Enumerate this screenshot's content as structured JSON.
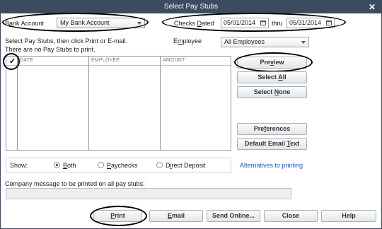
{
  "window": {
    "title": "Select Pay Stubs",
    "close_glyph": "✕"
  },
  "bank_account": {
    "label_prefix": "B",
    "label_underline": "a",
    "label_suffix": "nk Account",
    "value": "My Bank Account"
  },
  "checks_dated": {
    "label_prefix": "Checks ",
    "label_underline": "D",
    "label_suffix": "ated",
    "from": "05/01/2014",
    "thru_label": "thru",
    "to": "05/31/2014"
  },
  "instructions": {
    "line1": "Select Pay Stubs, then click Print or E-mail.",
    "line2": "There are no Pay Stubs to print."
  },
  "employee": {
    "label_prefix": "E",
    "label_underline": "m",
    "label_suffix": "ployee",
    "value": "All Employees"
  },
  "table": {
    "check_header": "✓",
    "columns": [
      "DATE",
      "EMPLOYEE",
      "AMOUNT"
    ]
  },
  "side_buttons": {
    "preview": {
      "prefix": "Pre",
      "underline": "v",
      "suffix": "iew"
    },
    "select_all": {
      "prefix": "Select ",
      "underline": "A",
      "suffix": "ll"
    },
    "select_none": {
      "prefix": "Select ",
      "underline": "N",
      "suffix": "one"
    },
    "preferences": {
      "prefix": "Pre",
      "underline": "f",
      "suffix": "erences"
    },
    "default_email": {
      "prefix": "Default Email ",
      "underline": "T",
      "suffix": "ext"
    }
  },
  "show": {
    "label": "Show:",
    "options": [
      {
        "prefix": "",
        "underline": "B",
        "suffix": "oth",
        "selected": true
      },
      {
        "prefix": "",
        "underline": "P",
        "suffix": "aychecks",
        "selected": false
      },
      {
        "prefix": "D",
        "underline": "i",
        "suffix": "rect Deposit",
        "selected": false
      }
    ],
    "alternatives_link": "Alternatives to printing"
  },
  "company_message": {
    "label": "Company message to be printed on all pay stubs:",
    "value": ""
  },
  "bottom_buttons": {
    "print": {
      "prefix": "",
      "underline": "P",
      "suffix": "rint"
    },
    "email": {
      "prefix": "",
      "underline": "E",
      "suffix": "mail"
    },
    "send_online": "Send Online...",
    "close": "Close",
    "help": "Help"
  },
  "colors": {
    "titlebar": "#3d4b5e",
    "link": "#1f5fbf",
    "annotation_ring": "#000000"
  }
}
